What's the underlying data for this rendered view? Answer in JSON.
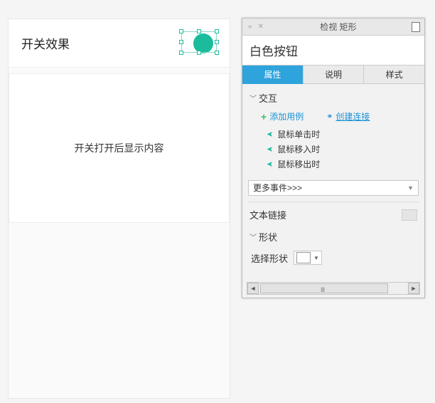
{
  "preview": {
    "title": "开关效果",
    "body_text": "开关打开后显示内容"
  },
  "panel": {
    "header_title": "检视 矩形",
    "element_name": "白色按钮",
    "tabs": {
      "properties": "属性",
      "notes": "说明",
      "style": "样式"
    },
    "sections": {
      "interaction_title": "交互",
      "add_case": "添加用例",
      "create_link": "创建连接",
      "events": [
        "鼠标单击时",
        "鼠标移入时",
        "鼠标移出时"
      ],
      "more_events": "更多事件>>>",
      "text_link": "文本链接",
      "shape_title": "形状",
      "select_shape": "选择形状"
    }
  }
}
